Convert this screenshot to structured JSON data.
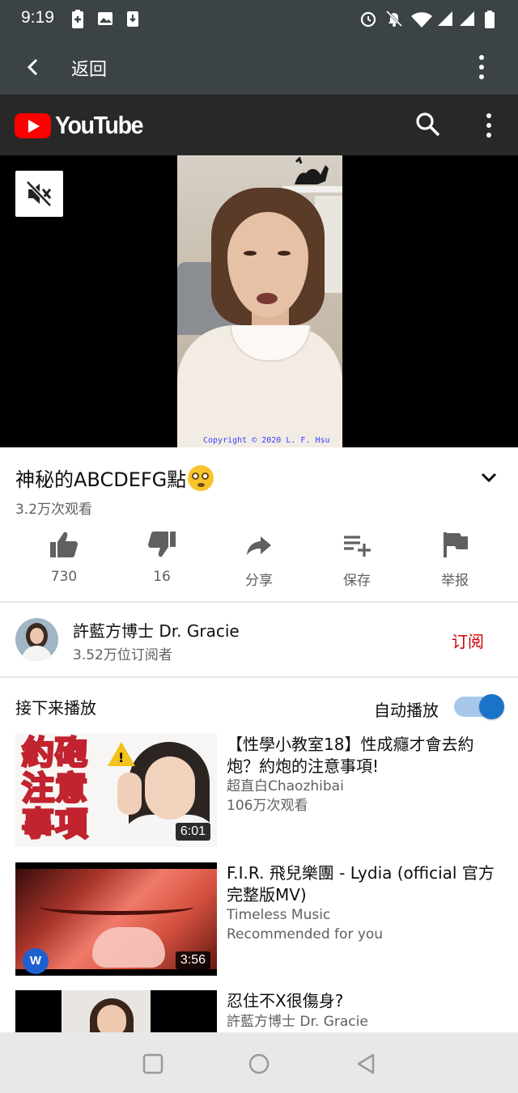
{
  "status_bar": {
    "time": "9:19"
  },
  "app_bar": {
    "back_label": "返回"
  },
  "youtube": {
    "logo_text": "YouTube"
  },
  "player": {
    "copyright": "Copyright © 2020 L. F. Hsu"
  },
  "video": {
    "title": "神秘的ABCDEFG點",
    "views": "3.2万次观看",
    "actions": [
      {
        "icon": "thumbs-up-icon",
        "label": "730"
      },
      {
        "icon": "thumbs-down-icon",
        "label": "16"
      },
      {
        "icon": "share-icon",
        "label": "分享"
      },
      {
        "icon": "playlist-add-icon",
        "label": "保存"
      },
      {
        "icon": "flag-icon",
        "label": "举报"
      }
    ]
  },
  "channel": {
    "name": "許藍方博士 Dr. Gracie",
    "subscribers": "3.52万位订阅者",
    "subscribe_label": "订阅"
  },
  "up_next": {
    "heading": "接下来播放",
    "autoplay_label": "自动播放",
    "autoplay_on": true,
    "items": [
      {
        "title": "【性學小教室18】性成癮才會去約炮？約炮的注意事項!",
        "channel": "超直白Chaozhibai",
        "meta": "106万次观看",
        "duration": "6:01",
        "thumb_text": "約砲注意事項"
      },
      {
        "title": "F.I.R. 飛兒樂團 - Lydia (official 官方完整版MV)",
        "channel": "Timeless Music",
        "meta": "Recommended for you",
        "duration": "3:56"
      },
      {
        "title": "忍住不X很傷身?",
        "channel": "許藍方博士 Dr. Gracie"
      }
    ]
  },
  "colors": {
    "status_bar_bg": "#3c4346",
    "youtube_header_bg": "#282828",
    "youtube_red": "#ff0000",
    "subscribe_red": "#cc0000",
    "toggle_blue": "#1a73c9"
  }
}
